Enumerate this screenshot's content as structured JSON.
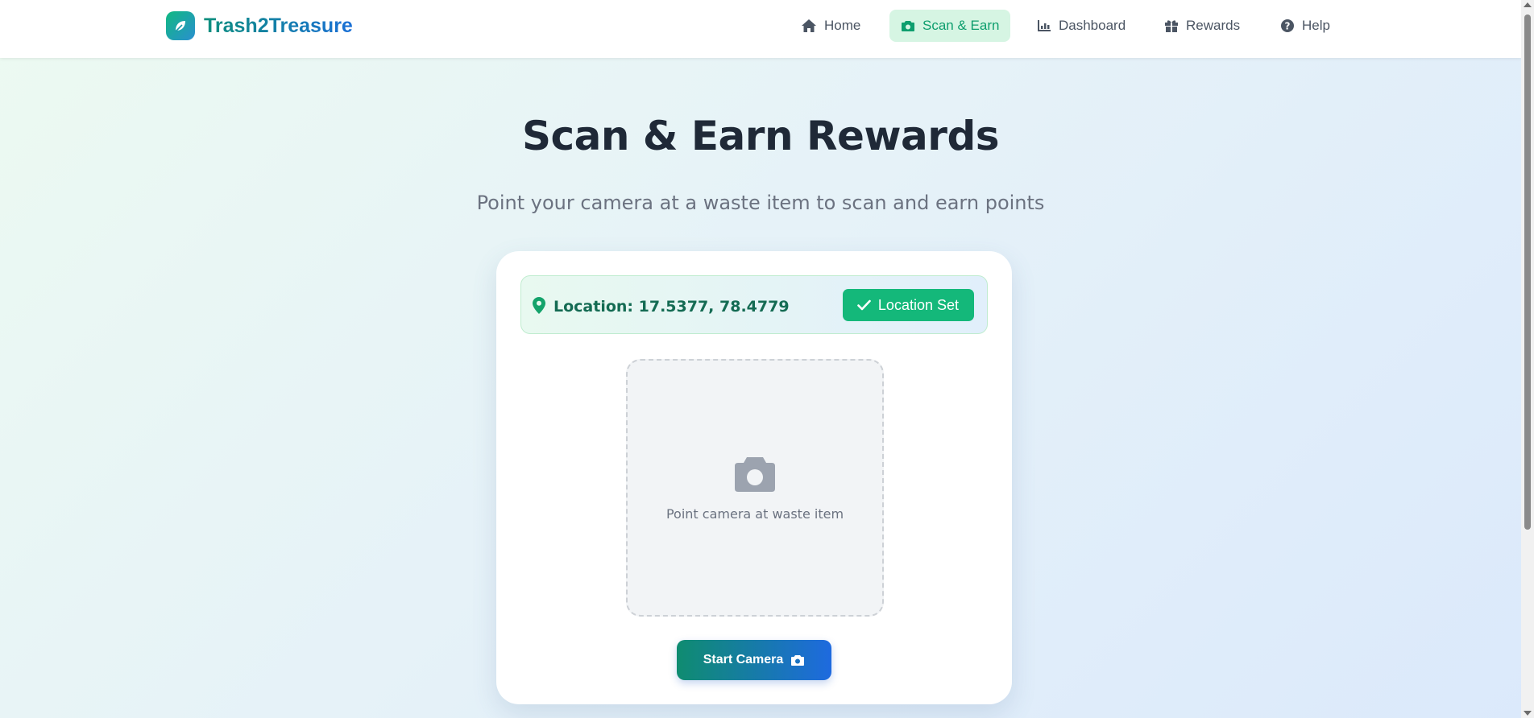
{
  "brand": {
    "name": "Trash2Treasure",
    "logo_icon": "leaf-icon"
  },
  "nav": {
    "items": [
      {
        "label": "Home",
        "icon": "home-icon",
        "active": false
      },
      {
        "label": "Scan & Earn",
        "icon": "camera-icon",
        "active": true
      },
      {
        "label": "Dashboard",
        "icon": "chart-icon",
        "active": false
      },
      {
        "label": "Rewards",
        "icon": "gift-icon",
        "active": false
      },
      {
        "label": "Help",
        "icon": "question-icon",
        "active": false
      }
    ]
  },
  "hero": {
    "title": "Scan & Earn Rewards",
    "subtitle": "Point your camera at a waste item to scan and earn points"
  },
  "location": {
    "text": "Location: 17.5377, 78.4779",
    "button_label": "Location Set"
  },
  "camera": {
    "hint": "Point camera at waste item",
    "start_button": "Start Camera"
  },
  "colors": {
    "accent_green": "#14b87a",
    "active_nav_bg": "#d6f5e3",
    "gradient_start": "#0f8c70",
    "gradient_end": "#1e6adf"
  }
}
